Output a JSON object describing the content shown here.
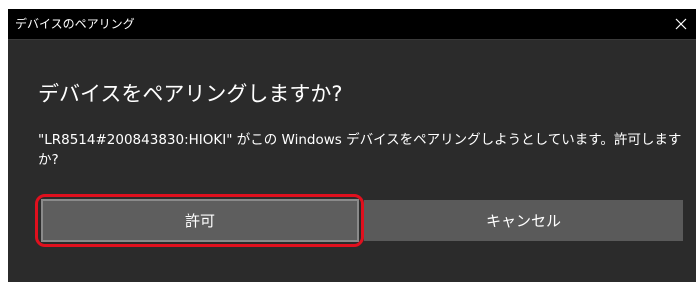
{
  "window": {
    "title": "デバイスのペアリング",
    "close_icon": "close-icon"
  },
  "dialog": {
    "heading": "デバイスをペアリングしますか?",
    "message": "\"LR8514#200843830:HIOKI\" がこの Windows デバイスをペアリングしようとしています。許可しますか?"
  },
  "buttons": {
    "allow_label": "許可",
    "cancel_label": "キャンセル"
  },
  "colors": {
    "titlebar": "#000000",
    "dialog_bg": "#2b2b2b",
    "button_bg": "#5e5e5e",
    "highlight": "#e0101e",
    "text": "#ffffff"
  }
}
